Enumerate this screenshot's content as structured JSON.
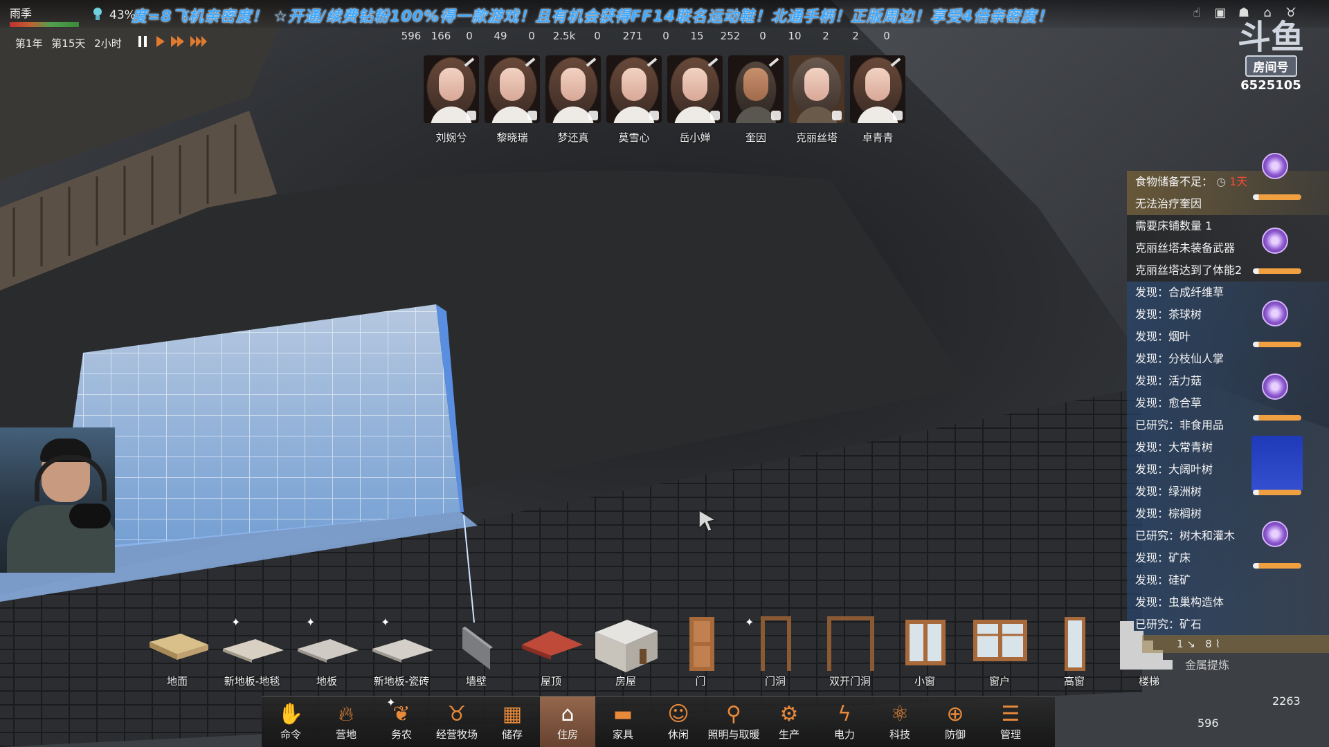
{
  "top": {
    "season": "雨季",
    "season_bar_colors": [
      "#c03030",
      "#50a050"
    ],
    "temperature": "43%",
    "marquee": "度=8飞机亲密度！ ☆开通/续费钻粉100%得一款游戏！且有机会获得FF14联名运动鞋！北通手柄！正版周边！享受4倍亲密度！",
    "date": "第1年 第15天 2小时",
    "speed_controls": [
      "pause",
      "play",
      "fast",
      "fastest"
    ]
  },
  "resources": [
    "596",
    "166",
    "0",
    "49",
    "0",
    "2.5k",
    "0",
    "271",
    "0",
    "15",
    "252",
    "0",
    "10",
    "2",
    "2",
    "0"
  ],
  "colonists": [
    {
      "name": "刘婉兮",
      "status": "gear-icon"
    },
    {
      "name": "黎晓瑞",
      "status": "box-icon"
    },
    {
      "name": "梦还真",
      "status": "hammer-icon"
    },
    {
      "name": "莫雪心",
      "status": "box-icon"
    },
    {
      "name": "岳小婵",
      "status": "box-icon"
    },
    {
      "name": "奎因",
      "status": "hammer-icon"
    },
    {
      "name": "克丽丝塔",
      "status": "sleep-icon"
    },
    {
      "name": "卓青青",
      "status": "hammer-icon"
    }
  ],
  "room": {
    "mark": "斗鱼",
    "label": "房间号",
    "number": "6525105"
  },
  "notifications": [
    {
      "text": "食物储备不足：",
      "extra": "1天",
      "style": "gold"
    },
    {
      "text": "无法治疗奎因",
      "style": "gold"
    },
    {
      "text": "需要床铺数量 1",
      "style": "dark"
    },
    {
      "text": "克丽丝塔未装备武器",
      "style": "dark"
    },
    {
      "text": "克丽丝塔达到了体能2",
      "style": "dark"
    },
    {
      "text": "发现：合成纤维草",
      "style": "blue"
    },
    {
      "text": "发现：茶球树",
      "style": "blue"
    },
    {
      "text": "发现：烟叶",
      "style": "blue"
    },
    {
      "text": "发现：分枝仙人掌",
      "style": "blue"
    },
    {
      "text": "发现：活力菇",
      "style": "blue"
    },
    {
      "text": "发现：愈合草",
      "style": "blue"
    },
    {
      "text": "已研究：非食用品",
      "style": "blue"
    },
    {
      "text": "发现：大常青树",
      "style": "blue"
    },
    {
      "text": "发现：大阔叶树",
      "style": "blue"
    },
    {
      "text": "发现：绿洲树",
      "style": "blue"
    },
    {
      "text": "发现：棕榈树",
      "style": "blue"
    },
    {
      "text": "已研究：树木和灌木",
      "style": "blue"
    },
    {
      "text": "发现：矿床",
      "style": "blue"
    },
    {
      "text": "发现：硅矿",
      "style": "blue"
    },
    {
      "text": "发现：虫巢构造体",
      "style": "blue"
    },
    {
      "text": "已研究：矿石",
      "style": "blue"
    }
  ],
  "build_items": [
    {
      "label": "地面",
      "new": false
    },
    {
      "label": "新地板-地毯",
      "new": true
    },
    {
      "label": "地板",
      "new": true
    },
    {
      "label": "新地板-瓷砖",
      "new": true
    },
    {
      "label": "墙壁",
      "new": false
    },
    {
      "label": "屋顶",
      "new": false
    },
    {
      "label": "房屋",
      "new": false
    },
    {
      "label": "门",
      "new": false
    },
    {
      "label": "门洞",
      "new": true
    },
    {
      "label": "双开门洞",
      "new": false
    },
    {
      "label": "小窗",
      "new": false
    },
    {
      "label": "窗户",
      "new": false
    },
    {
      "label": "高窗",
      "new": false
    },
    {
      "label": "楼梯",
      "new": false
    }
  ],
  "stairs_counts": {
    "a": "1",
    "b": "8"
  },
  "metal_label": "金属提炼",
  "nav": [
    {
      "label": "命令",
      "icon": "hand-icon"
    },
    {
      "label": "营地",
      "icon": "fire-icon"
    },
    {
      "label": "务农",
      "icon": "plant-icon",
      "new": true
    },
    {
      "label": "经营牧场",
      "icon": "cow-icon"
    },
    {
      "label": "储存",
      "icon": "storage-icon"
    },
    {
      "label": "住房",
      "icon": "house-icon",
      "active": true
    },
    {
      "label": "家具",
      "icon": "bed-icon"
    },
    {
      "label": "休闲",
      "icon": "mask-icon"
    },
    {
      "label": "照明与取暖",
      "icon": "torch-icon"
    },
    {
      "label": "生产",
      "icon": "gear-icon"
    },
    {
      "label": "电力",
      "icon": "bolt-icon"
    },
    {
      "label": "科技",
      "icon": "atom-icon"
    },
    {
      "label": "防御",
      "icon": "target-icon"
    },
    {
      "label": "管理",
      "icon": "menu-icon"
    }
  ],
  "minimap": {
    "value_a": "2263",
    "value_b": "596"
  },
  "colors": {
    "blueprint": "#7fb8ff",
    "accent": "#e88a3a",
    "marquee": "#3fa8ff"
  }
}
